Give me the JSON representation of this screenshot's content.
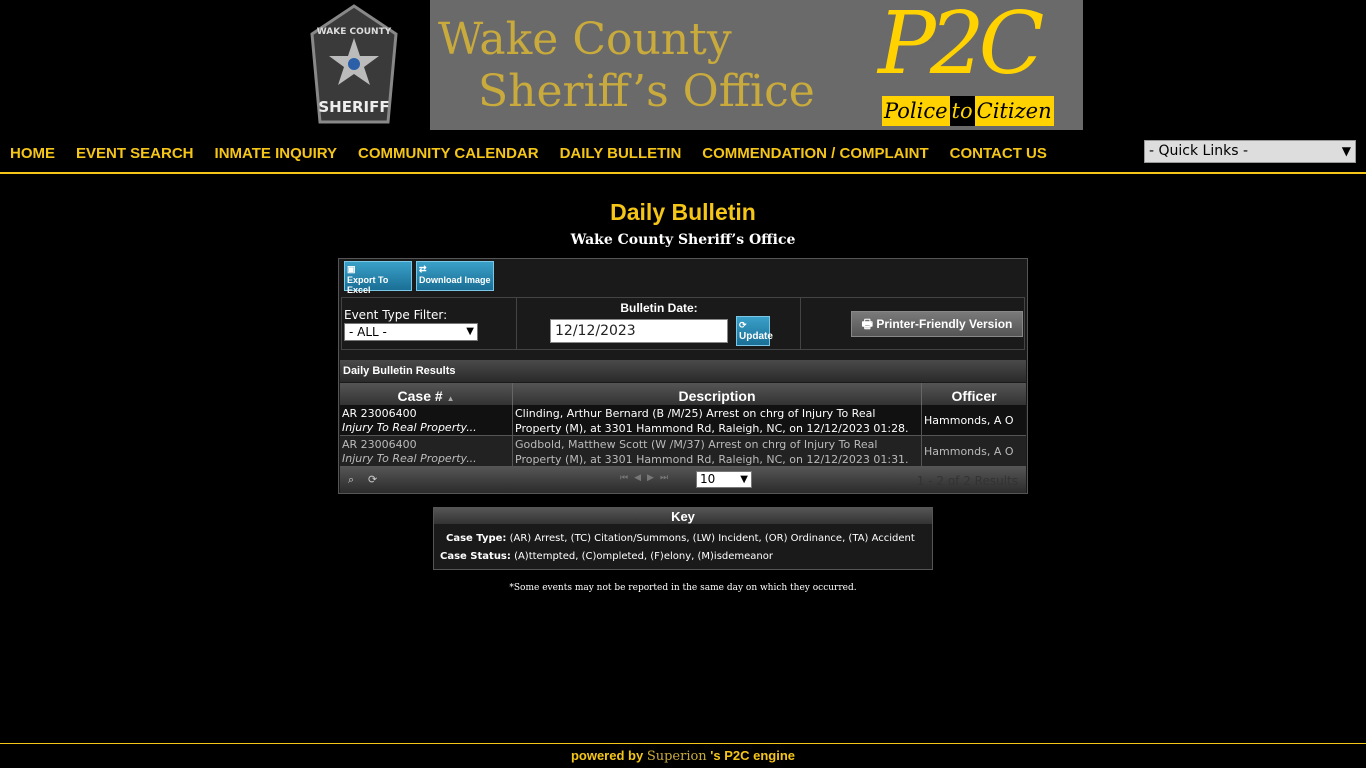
{
  "header": {
    "badge_text_top": "WAKE COUNTY",
    "badge_text_bottom": "SHERIFF",
    "banner_line1": "Wake County",
    "banner_line2": "Sheriff’s Office",
    "logo_text": "P2C",
    "logo_tag_police": "Police",
    "logo_tag_to": "to",
    "logo_tag_citizen": "Citizen"
  },
  "nav": {
    "items": [
      "HOME",
      "EVENT SEARCH",
      "INMATE INQUIRY",
      "COMMUNITY CALENDAR",
      "DAILY BULLETIN",
      "COMMENDATION / COMPLAINT",
      "CONTACT US"
    ],
    "quick_links": "- Quick Links -"
  },
  "page": {
    "title": "Daily Bulletin",
    "subtitle": "Wake County Sheriff’s Office"
  },
  "toolbar": {
    "export_label": "Export To Excel",
    "download_label": "Download Image"
  },
  "filters": {
    "event_type_label": "Event Type Filter:",
    "event_type_value": "- ALL -",
    "bulletin_date_label": "Bulletin Date:",
    "bulletin_date_value": "12/12/2023",
    "update_label": "Update",
    "print_label": "Printer-Friendly Version"
  },
  "results": {
    "heading": "Daily Bulletin Results",
    "columns": [
      "Case #",
      "Description",
      "Officer"
    ],
    "rows": [
      {
        "case_num": "AR 23006400",
        "case_type": "Injury To Real Property...",
        "description": "Clinding, Arthur Bernard (B /M/25) Arrest on chrg of Injury To Real Property (M), at 3301 Hammond Rd, Raleigh, NC, on 12/12/2023 01:28.",
        "officer": "Hammonds, A O"
      },
      {
        "case_num": "AR 23006400",
        "case_type": "Injury To Real Property...",
        "description": "Godbold, Matthew Scott (W /M/37) Arrest on chrg of Injury To Real Property (M), at 3301 Hammond Rd, Raleigh, NC, on 12/12/2023 01:31.",
        "officer": "Hammonds, A O"
      }
    ],
    "page_size": "10",
    "summary": "1 - 2 of 2 Results"
  },
  "key": {
    "title": "Key",
    "case_type_label": "Case Type:",
    "case_type_text": " (AR) Arrest, (TC) Citation/Summons, (LW) Incident, (OR) Ordinance, (TA) Accident",
    "case_status_label": "Case Status:",
    "case_status_text": " (A)ttempted, (C)ompleted, (F)elony, (M)isdemeanor"
  },
  "footnote": "*Some events may not be reported in the same day on which they occurred.",
  "footer": {
    "prefix": "powered by ",
    "brand": "Superion",
    "suffix": " 's P2C engine"
  },
  "colors": {
    "accent": "#f5c518",
    "background": "#000000",
    "button_blue": "#1a6f96"
  }
}
